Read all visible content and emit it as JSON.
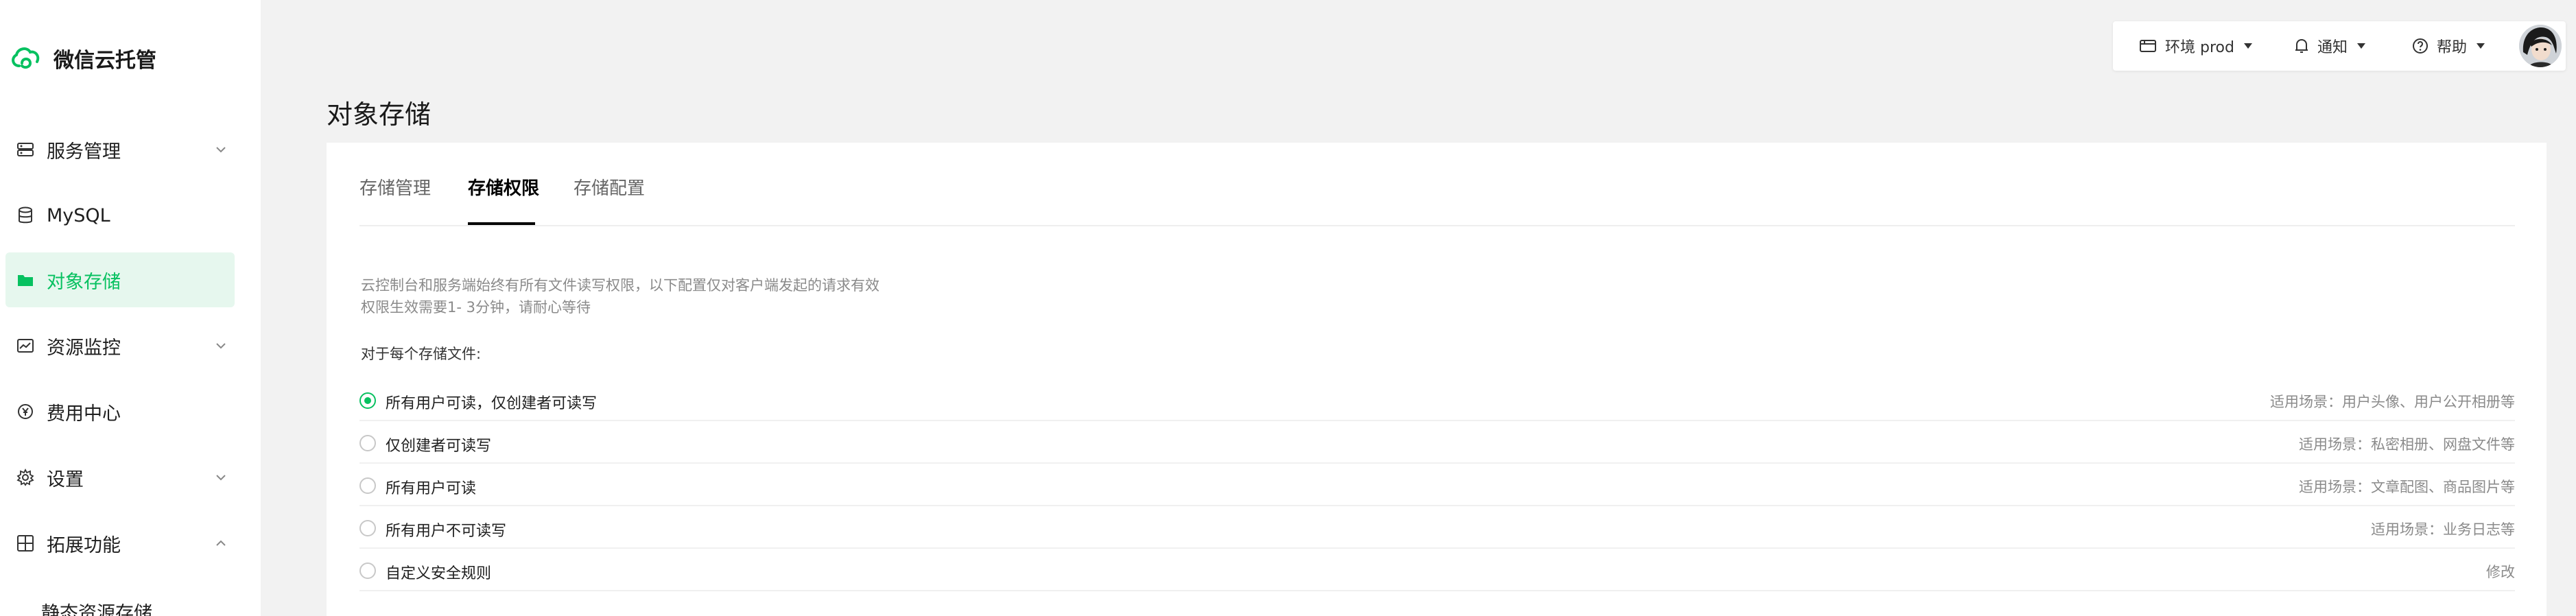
{
  "app": {
    "title": "微信云托管"
  },
  "sidebar": {
    "items": [
      {
        "label": "服务管理",
        "icon": "server-icon"
      },
      {
        "label": "MySQL",
        "icon": "database-icon"
      },
      {
        "label": "对象存储",
        "icon": "folder-icon"
      },
      {
        "label": "资源监控",
        "icon": "monitor-chart-icon"
      },
      {
        "label": "费用中心",
        "icon": "yen-icon"
      },
      {
        "label": "设置",
        "icon": "gear-icon"
      },
      {
        "label": "拓展功能",
        "icon": "grid-icon"
      }
    ],
    "sub_items": [
      {
        "label": "静态资源存储"
      }
    ]
  },
  "topbar": {
    "env_label": "环境 prod",
    "notify_label": "通知",
    "help_label": "帮助"
  },
  "page": {
    "title": "对象存储"
  },
  "tabs": [
    {
      "label": "存储管理"
    },
    {
      "label": "存储权限"
    },
    {
      "label": "存储配置"
    }
  ],
  "permission": {
    "desc_line1": "云控制台和服务端始终有所有文件读写权限，以下配置仅对客户端发起的请求有效",
    "desc_line2": "权限生效需要1- 3分钟，请耐心等待",
    "section_label": "对于每个存储文件:",
    "options": [
      {
        "label": "所有用户可读，仅创建者可读写",
        "scene": "适用场景：用户头像、用户公开相册等",
        "checked": true
      },
      {
        "label": "仅创建者可读写",
        "scene": "适用场景：私密相册、网盘文件等",
        "checked": false
      },
      {
        "label": "所有用户可读",
        "scene": "适用场景：文章配图、商品图片等",
        "checked": false
      },
      {
        "label": "所有用户不可读写",
        "scene": "适用场景：业务日志等",
        "checked": false
      },
      {
        "label": "自定义安全规则",
        "scene": "修改",
        "checked": false
      }
    ]
  },
  "colors": {
    "accent": "#07c160",
    "active_bg": "#e6f7ee"
  }
}
